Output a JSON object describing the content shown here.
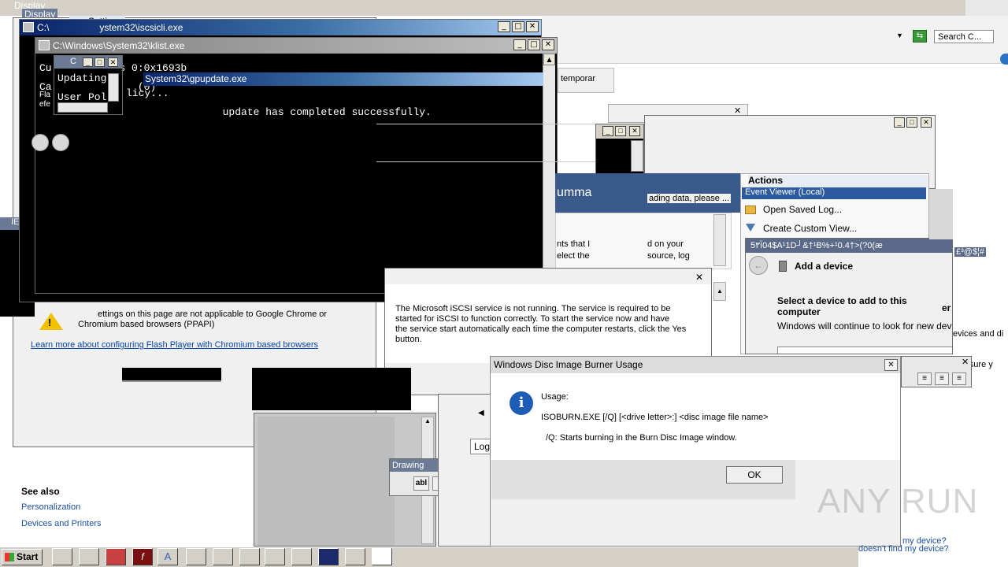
{
  "windows": {
    "display_back": {
      "title": "Display"
    },
    "display_back2": {
      "title": "Display"
    },
    "flash_settings": {
      "title": "yer Settings",
      "warning_text_1": "ettings on this page are not applicable to Google Chrome or",
      "warning_text_2": "Chromium based browsers (PPAPI)",
      "link": "Learn more about configuring Flash Player with Chromium based browsers"
    },
    "see_also": {
      "heading": "See also",
      "links": [
        "Personalization",
        "Devices and Printers"
      ]
    },
    "iscsicli": {
      "title": "C:\\Windows\\System32\\iscsicli.exe",
      "title_visible": "ystem32\\iscsicli.exe",
      "title_prefix": "C:\\"
    },
    "klist": {
      "title": "C:\\Windows\\System32\\klist.exe",
      "lines": [
        "Cu        d is 0:0x1693b",
        "Ca              (0)",
        "Fla",
        "efe"
      ]
    },
    "gpupdate": {
      "title": "System32\\gpupdate.exe",
      "lines": [
        "Updating",
        "User Pol          licy...",
        "",
        "            update has completed successfully."
      ]
    },
    "small_window": {
      "title": "C"
    },
    "ie_window": {
      "title": "IEx"
    },
    "event_viewer": {
      "search_placeholder": "Search C...",
      "temporary_text": "temporar",
      "summary_text": "umma",
      "loading_text": "ading data, please ...",
      "body_text_1": "nts that I",
      "body_text_2": "d on your",
      "body_text_3": "elect the",
      "body_text_4": "source, log",
      "actions_header": "Actions",
      "event_viewer_local": "Event Viewer (Local)",
      "actions": [
        "Open Saved Log...",
        "Create Custom View..."
      ],
      "log_tab": "Log"
    },
    "add_device": {
      "title_garbled": "5۳Ï04$A¹1D┘&†¹B%+¹0.4†>(?0(æ",
      "title_garbled_2": "£³@$¦#",
      "heading": "Add a device",
      "subheading": "Select a device to add to this computer",
      "body": "Windows will continue to look for new dev",
      "side_text_1": "evices and di",
      "side_text_2": "ake sure y",
      "footer_1": "my device?",
      "footer_2": "doesn't find my device?",
      "footer_3": "esn't find my device?",
      "side_text_3": "er"
    },
    "iscsi_msg": {
      "lines": [
        "The Microsoft iSCSI service is not running. The service is required to be",
        "started for iSCSI to function correctly. To start the service now and have",
        "the service start automatically each time the computer restarts, click the Yes",
        "button."
      ]
    },
    "drawing_toolbar": {
      "title": "Drawing",
      "tool": "abl"
    },
    "isoburn": {
      "title": "Windows Disc Image Burner Usage",
      "usage_label": "Usage:",
      "syntax": "ISOBURN.EXE [/Q] [<drive letter>:] <disc image file name>",
      "option": "/Q: Starts burning in the Burn Disc Image window.",
      "ok": "OK"
    }
  },
  "taskbar": {
    "start": "Start",
    "buttons": [
      "window",
      "notepad",
      "printer",
      "flash",
      "fonts",
      "window",
      "window",
      "document",
      "window",
      "install",
      "note",
      "notepad",
      "window"
    ]
  },
  "watermark": "ANY RUN",
  "colors": {
    "title_active": "#0a246a",
    "title_gradient_end": "#a6caf0",
    "console_bg": "#000000",
    "console_fg": "#c0c0c0",
    "link": "#0645ad",
    "dialog_bg": "#f0f0f0"
  }
}
